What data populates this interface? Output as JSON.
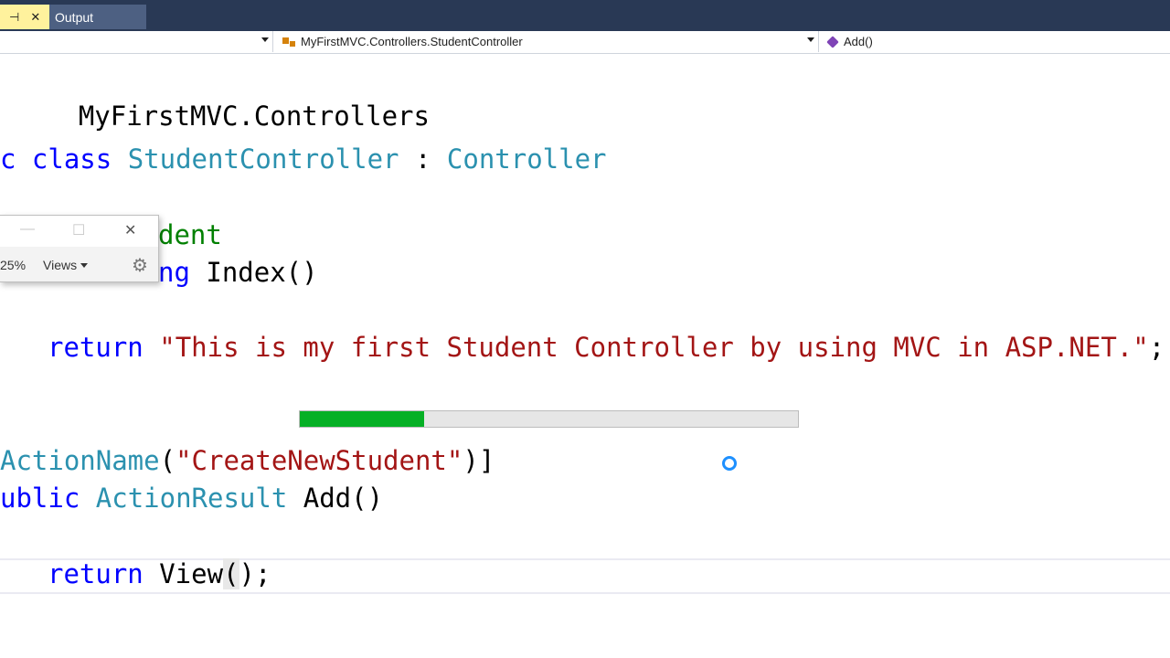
{
  "tabs": {
    "pinned_glyph": "⊣",
    "close_glyph": "✕",
    "output_label": "Output"
  },
  "navbar": {
    "class_path": "MyFirstMVC.Controllers.StudentController",
    "member": "Add()"
  },
  "code": {
    "l1": "MyFirstMVC.Controllers",
    "l2_kw1": "c ",
    "l2_kw2": "class",
    "l2_type": "StudentController",
    "l2_colon": " : ",
    "l2_base": "Controller",
    "l3_comment": "dent",
    "l4_kw": "ng",
    "l4_rest": " Index()",
    "l5_kw": "return",
    "l5_str": "\"This is my first Student Controller by using MVC in ASP.NET.\"",
    "l5_end": ";",
    "l6_type": "ActionName",
    "l6_open": "(",
    "l6_str": "\"CreateNewStudent\"",
    "l6_close": ")]",
    "l7_kw": "ublic",
    "l7_type": "ActionResult",
    "l7_rest": " Add()",
    "l8_kw": "return",
    "l8_a": " View",
    "l8_b": "(",
    "l8_c": ");"
  },
  "progress": {
    "value_percent": 25,
    "fill_color": "#06b025"
  },
  "mini_window": {
    "minimize": "—",
    "maximize": "☐",
    "close": "✕",
    "zoom": "25%",
    "views_label": "Views",
    "settings_icon": "gear-icon"
  },
  "colors": {
    "keyword": "#0000ff",
    "type": "#2b91af",
    "string": "#a31515",
    "comment": "#008000"
  }
}
